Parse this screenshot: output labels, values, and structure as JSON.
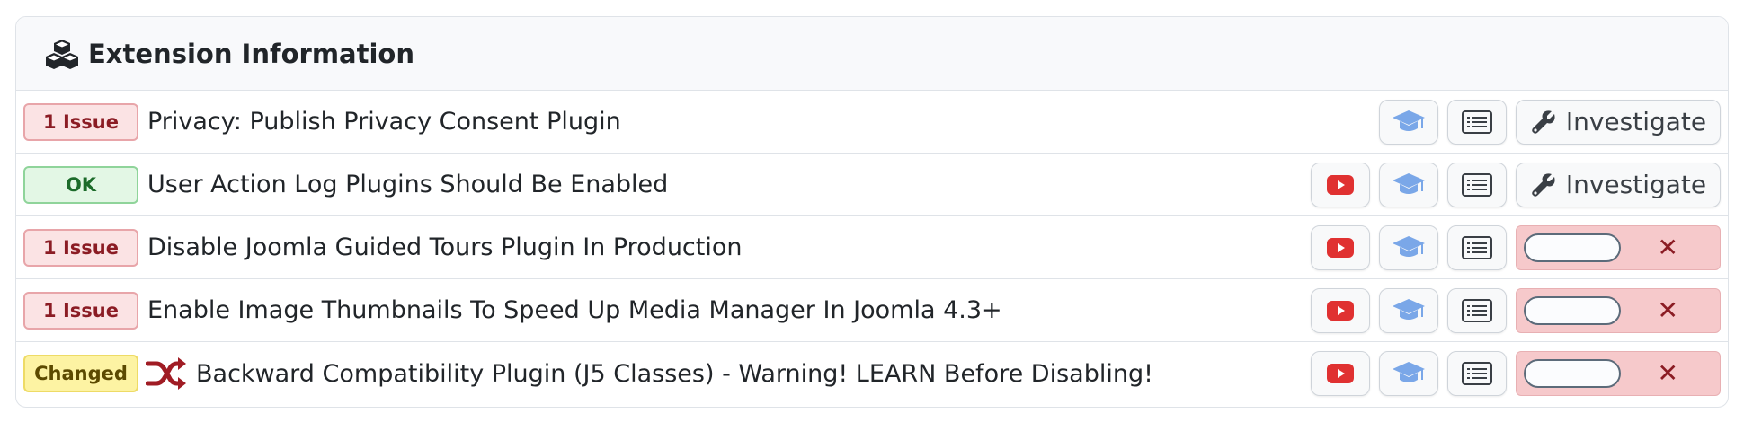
{
  "panel": {
    "title": "Extension Information",
    "title_icon": "cubes-icon"
  },
  "rows": [
    {
      "status": "1 Issue",
      "status_type": "issue",
      "label": "Privacy: Publish Privacy Consent Plugin",
      "actions": [
        "learn",
        "details",
        "investigate"
      ],
      "investigate_label": "Investigate"
    },
    {
      "status": "OK",
      "status_type": "ok",
      "label": "User Action Log Plugins Should Be Enabled",
      "actions": [
        "video",
        "learn",
        "details",
        "investigate"
      ],
      "investigate_label": "Investigate"
    },
    {
      "status": "1 Issue",
      "status_type": "issue",
      "label": "Disable Joomla Guided Tours Plugin In Production",
      "actions": [
        "video",
        "learn",
        "details",
        "toggle"
      ],
      "toggle_state": "off",
      "toggle_mark": "✕"
    },
    {
      "status": "1 Issue",
      "status_type": "issue",
      "label": "Enable Image Thumbnails To Speed Up Media Manager In Joomla 4.3+",
      "actions": [
        "video",
        "learn",
        "details",
        "toggle"
      ],
      "toggle_state": "off",
      "toggle_mark": "✕"
    },
    {
      "status": "Changed",
      "status_type": "changed",
      "label": "Backward Compatibility Plugin (J5 Classes) - Warning! LEARN Before Disabling!",
      "actions": [
        "video",
        "learn",
        "details",
        "toggle"
      ],
      "toggle_state": "off",
      "toggle_mark": "✕"
    }
  ],
  "colors": {
    "issue": "#8b1c24",
    "ok": "#1c6b2a",
    "changed_bg": "#fdf3a3",
    "youtube": "#e03131",
    "learn": "#7aa7e8",
    "toggle_bg": "#f6c9cb"
  },
  "icons": {
    "video": "youtube-icon",
    "learn": "graduation-cap-icon",
    "details": "list-icon",
    "investigate": "wrench-icon",
    "changed": "shuffle-icon"
  }
}
